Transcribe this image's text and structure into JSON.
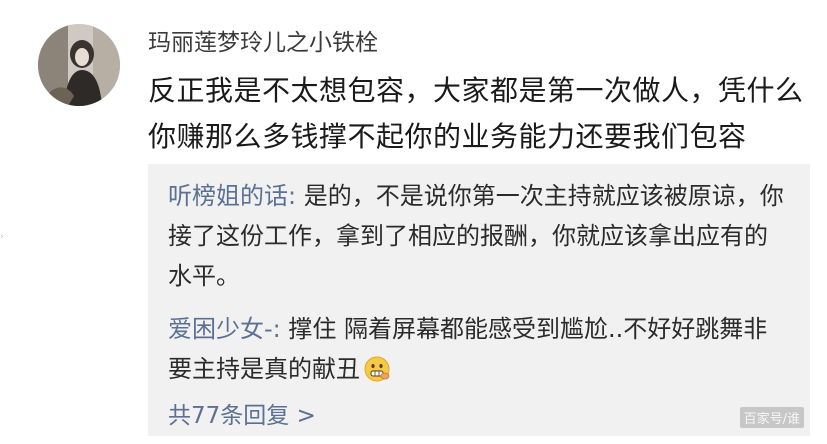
{
  "comment": {
    "username": "玛丽莲梦玲儿之小铁栓",
    "text": "反正我是不太想包容，大家都是第一次做人，凭什么你赚那么多钱撑不起你的业务能力还要我们包容"
  },
  "replies": [
    {
      "author": "听榜姐的话",
      "separator": ":",
      "text": " 是的，不是说你第一次主持就应该被原谅，你接了这份工作，拿到了相应的报酬，你就应该拿出应有的水平。"
    },
    {
      "author": "爱困少女-",
      "separator": ":",
      "text": " 撑住  隔着屏幕都能感受到尴尬..不好好跳舞非要主持是真的献丑",
      "emoji": "grimace-face-icon"
    }
  ],
  "more_replies_label": "共77条回复 >",
  "watermark": "百家号/谁",
  "colors": {
    "author_link": "#5b7193",
    "reply_background": "#f1f1f1",
    "text": "#1a1a1a"
  }
}
